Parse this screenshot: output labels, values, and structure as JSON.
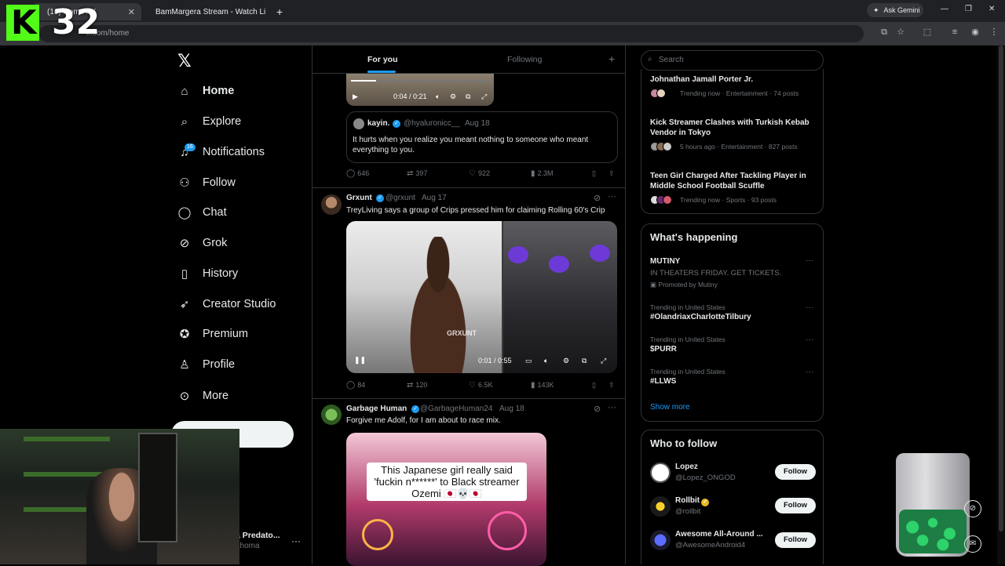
{
  "browser": {
    "tabs": [
      {
        "label": "(16) Home / X",
        "active": true
      },
      {
        "label": "BamMargera Stream - Watch Li",
        "active": false
      }
    ],
    "url": "x.com/home",
    "ask_gemini": "Ask Gemini"
  },
  "kick_overlay": {
    "count": "32"
  },
  "nav": {
    "items": [
      {
        "label": "Home",
        "icon": "home-icon"
      },
      {
        "label": "Explore",
        "icon": "search-icon"
      },
      {
        "label": "Notifications",
        "icon": "bell-icon",
        "badge": "16"
      },
      {
        "label": "Follow",
        "icon": "person-add-icon"
      },
      {
        "label": "Chat",
        "icon": "chat-icon"
      },
      {
        "label": "Grok",
        "icon": "grok-icon"
      },
      {
        "label": "History",
        "icon": "bookmark-icon"
      },
      {
        "label": "Creator Studio",
        "icon": "rocket-icon"
      },
      {
        "label": "Premium",
        "icon": "verified-icon"
      },
      {
        "label": "Profile",
        "icon": "person-icon"
      },
      {
        "label": "More",
        "icon": "more-circle-icon"
      }
    ],
    "post_button": "t",
    "account": {
      "name": "a Predato...",
      "handle": "ahoma"
    }
  },
  "feed": {
    "tabs": {
      "for_you": "For you",
      "following": "Following"
    },
    "post1": {
      "video_time": "0:04 / 0:21",
      "quote": {
        "name": "kayin.",
        "handle": "@hyaluronicc__",
        "date": "Aug 18",
        "text": "It hurts when you realize you meant nothing to someone who meant everything to you."
      },
      "stats": {
        "replies": "646",
        "reposts": "397",
        "likes": "922",
        "views": "2.3M"
      }
    },
    "post2": {
      "name": "Grxunt",
      "handle": "@grxunt",
      "date": "Aug 17",
      "text": "TreyLiving says a group of Crips pressed him for claiming Rolling 60's Crip",
      "video_time": "0:01 / 0:55",
      "watermark": "GRXUNT",
      "stats": {
        "replies": "84",
        "reposts": "120",
        "likes": "6.5K",
        "views": "143K"
      }
    },
    "post3": {
      "name": "Garbage Human",
      "handle": "@GarbageHuman24",
      "date": "Aug 18",
      "text": "Forgive me Adolf, for I am about to race mix.",
      "caption": "This Japanese girl really said 'fuckin n******' to Black streamer Ozemi 🇯🇵💀🇯🇵"
    }
  },
  "sidebar": {
    "search_placeholder": "Search",
    "trending_news": [
      {
        "title": "Johnathan Jamall Porter Jr.",
        "meta": "Trending now · Entertainment · 74 posts"
      },
      {
        "title": "Kick Streamer Clashes with Turkish Kebab Vendor in Tokyo",
        "meta": "5 hours ago · Entertainment · 827 posts"
      },
      {
        "title": "Teen Girl Charged After Tackling Player in Middle School Football Scuffle",
        "meta": "Trending now · Sports · 93 posts"
      }
    ],
    "whats_happening": {
      "title": "What's happening",
      "promo": {
        "title": "MUTINY",
        "subtitle": "IN THEATERS FRIDAY. GET TICKETS.",
        "promoted": "Promoted by Mutiny"
      },
      "trends": [
        {
          "context": "Trending in United States",
          "title": "#OlandriaxCharlotteTilbury"
        },
        {
          "context": "Trending in United States",
          "title": "$PURR"
        },
        {
          "context": "Trending in United States",
          "title": "#LLWS"
        }
      ],
      "show_more": "Show more"
    },
    "who_to_follow": {
      "title": "Who to follow",
      "accounts": [
        {
          "name": "Lopez",
          "handle": "@Lopez_ONGOD",
          "button": "Follow"
        },
        {
          "name": "Rollbit",
          "handle": "@rollbit",
          "button": "Follow"
        },
        {
          "name": "Awesome All-Around ...",
          "handle": "@AwesomeAndroid4",
          "button": "Follow"
        }
      ]
    }
  },
  "colors": {
    "accent": "#1d9bf0",
    "background": "#000000",
    "border": "#2f3336",
    "kick": "#53fc18"
  }
}
